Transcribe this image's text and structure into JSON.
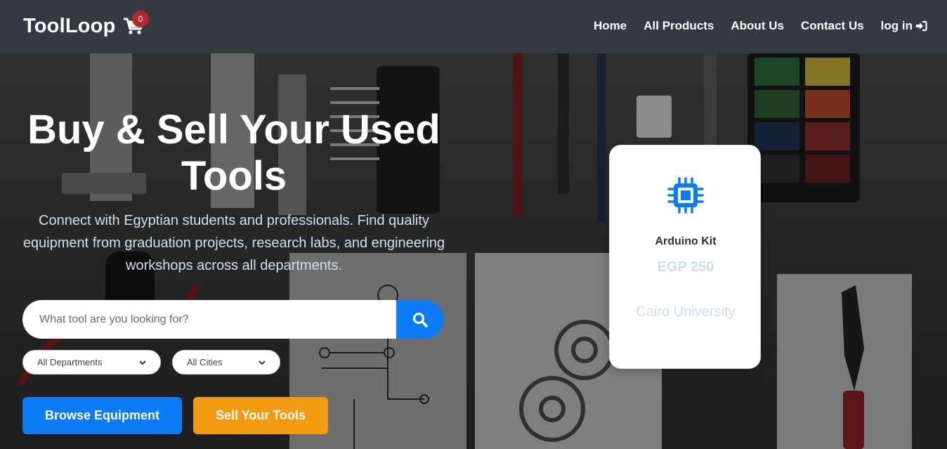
{
  "navbar": {
    "brand": "ToolLoop",
    "cart_count": "0",
    "links": [
      "Home",
      "All Products",
      "About Us",
      "Contact Us"
    ],
    "login_label": "log in"
  },
  "hero": {
    "headline": "Buy & Sell Your Used Tools",
    "subtext": "Connect with Egyptian students and professionals. Find quality equipment from graduation projects, research labs, and engineering workshops across all departments.",
    "search": {
      "placeholder": "What tool are you looking for?",
      "value": ""
    },
    "filters": {
      "department": "All Departments",
      "city": "All Cities"
    },
    "buttons": {
      "browse": "Browse Equipment",
      "sell": "Sell Your Tools"
    }
  },
  "featured_card": {
    "icon": "microchip-icon",
    "title": "Arduino Kit",
    "price": "EGP 250",
    "location": "Cairo University"
  },
  "colors": {
    "navbar": "#343a40",
    "primary": "#0d7bf6",
    "warning": "#f29a11",
    "badge": "#b3282d"
  }
}
